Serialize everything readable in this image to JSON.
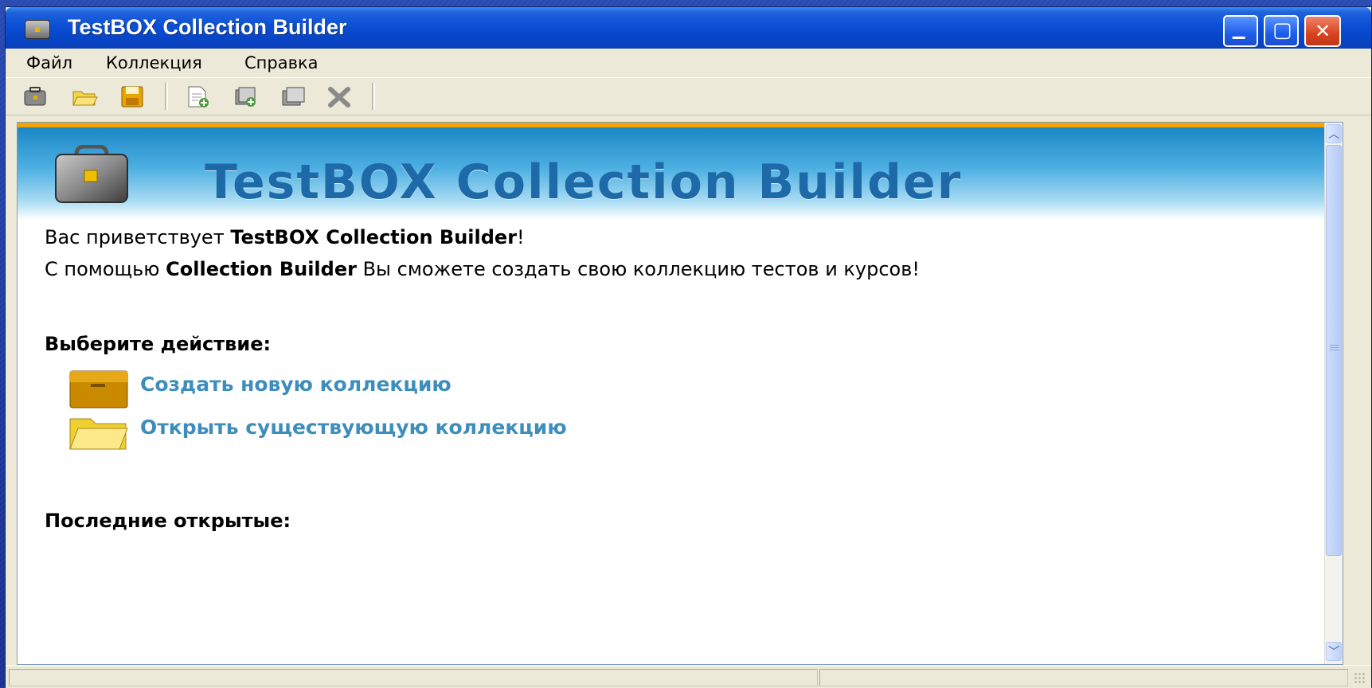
{
  "window": {
    "title": "TestBOX Collection Builder"
  },
  "titlebar_buttons": {
    "minimize_glyph": "▁",
    "maximize_glyph": "▢",
    "close_glyph": "✕"
  },
  "menu": {
    "items": [
      "Файл",
      "Коллекция",
      "Справка"
    ]
  },
  "toolbar": {
    "buttons": [
      "collection-icon",
      "open-folder-icon",
      "save-icon",
      "new-item-icon",
      "add-item-icon",
      "edit-item-icon",
      "delete-icon"
    ]
  },
  "banner": {
    "title": "TestBOX Collection Builder"
  },
  "welcome": {
    "line1_prefix": "Вас приветствует ",
    "line1_bold": "TestBOX Collection Builder",
    "line1_suffix": "!",
    "line2_prefix": "С помощью ",
    "line2_bold": "Collection Builder",
    "line2_suffix": " Вы сможете создать свою коллекцию тестов и курсов!"
  },
  "actions": {
    "heading": "Выберите действие:",
    "create_label": "Создать новую коллекцию",
    "open_label": "Открыть существующую коллекцию"
  },
  "recent": {
    "heading": "Последние открытые:"
  },
  "colors": {
    "link": "#3d8dbd",
    "banner_text": "#1e6aa8",
    "accent_bar": "#f5a300"
  }
}
